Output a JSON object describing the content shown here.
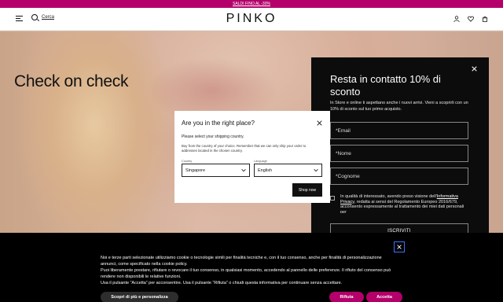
{
  "promo": {
    "text": "SALDI FINO AL -30%"
  },
  "header": {
    "search_label": "Cerca",
    "logo": "PINKO",
    "icons": [
      "menu-icon",
      "search-icon",
      "user-icon",
      "heart-icon",
      "bag-icon"
    ]
  },
  "hero": {
    "title": "Check on check"
  },
  "newsletter": {
    "title": "Resta in contatto 10% di sconto",
    "description": "In Store e online ti aspettano anche i nuovi arrivi. Vieni a scoprirli con un 10% di sconto sul tuo primo acquisto.",
    "email_placeholder": "*Email",
    "name_placeholder": "*Nome",
    "surname_placeholder": "*Cognome",
    "consent_prefix": "In qualità di interessato, avendo preso visione dell'",
    "consent_link": "Informativa Privacy",
    "consent_suffix": ", redatta ai sensi del Regolamento Europeo 2016/679, acconsento espressamente al trattamento dei miei dati personali per",
    "submit_label": "ISCRIVITI"
  },
  "region_modal": {
    "title": "Are you in the right place?",
    "subtitle": "Please select your shipping country.",
    "note": "Buy from the country of your choice. Remember that we can only ship your order to addresses located in the chosen country.",
    "country_label": "Country",
    "country_value": "Singapore",
    "language_label": "Language",
    "language_value": "English",
    "button_label": "Shop now"
  },
  "cookie_banner": {
    "text_lines": [
      "Noi e terze parti selezionate utilizziamo cookie o tecnologie simili per finalità tecniche e, con il tuo consenso, anche per finalità di personalizzazione annunci, come specificato nella cookie policy.",
      "Puoi liberamente prestare, rifiutare o revocare il tuo consenso, in qualsiasi momento, accedendo al pannello delle preferenze. Il rifiuto del consenso può rendere non disponibili le relative funzioni.",
      "Usa il pulsante “Accetta” per acconsentire. Usa il pulsante “Rifiuta” o chiudi questa informativa per continuare senza accettare."
    ],
    "more_label": "Scopri di più e personalizza",
    "reject_label": "Rifiuta",
    "accept_label": "Accetta"
  },
  "colors": {
    "brand": "#b4006a",
    "panel": "#0c0c0c",
    "focus": "#3f6dff"
  }
}
